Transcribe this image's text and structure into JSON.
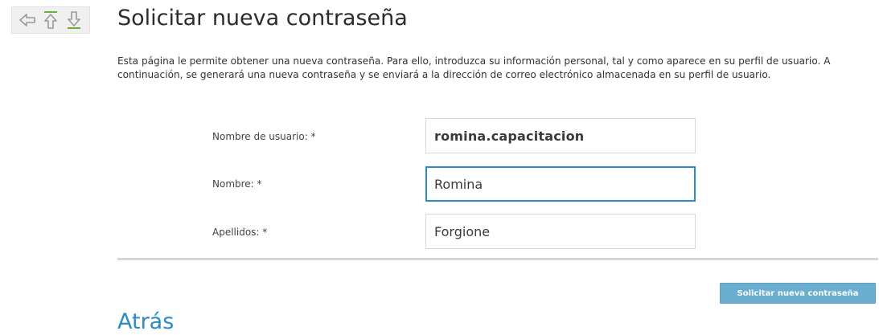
{
  "header": {
    "title": "Solicitar nueva contraseña",
    "nav_icons": [
      "back-arrow-icon",
      "up-arrow-icon",
      "down-arrow-icon"
    ]
  },
  "intro": {
    "text": "Esta página le permite obtener una nueva contraseña. Para ello, introduzca su información personal, tal y como aparece en su perfil de usuario. A continuación, se generará una nueva contraseña y se enviará a la dirección de correo electrónico almacenada en su perfil de usuario."
  },
  "form": {
    "username": {
      "label": "Nombre de usuario: *",
      "value": "romina.capacitacion"
    },
    "first_name": {
      "label": "Nombre: *",
      "value": "Romina"
    },
    "last_name": {
      "label": "Apellidos: *",
      "value": "Forgione"
    },
    "submit_label": "Solicitar nueva contraseña"
  },
  "footer": {
    "back_label": "Atrás"
  },
  "colors": {
    "accent": "#2a8bc7",
    "button": "#6aaed0",
    "icon_gray": "#9a9a9a",
    "icon_green": "#6cae3a"
  }
}
